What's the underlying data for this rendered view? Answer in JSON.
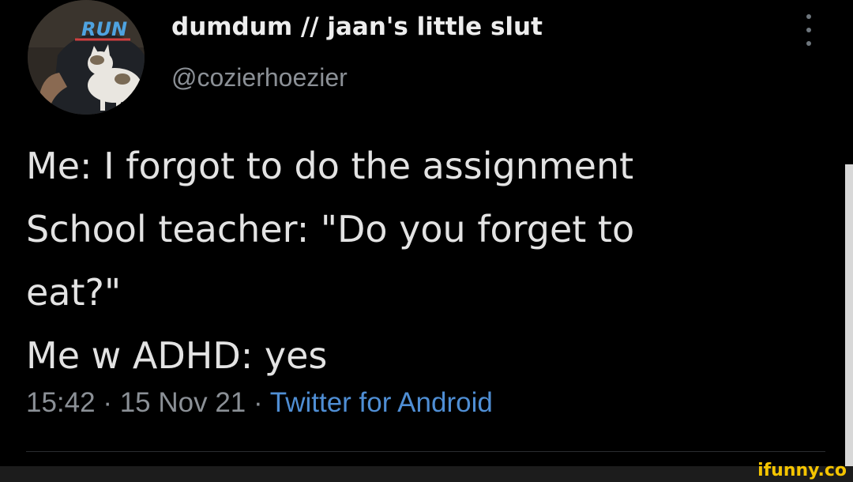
{
  "tweet": {
    "display_name": "dumdum // jaan's little slut",
    "handle": "@cozierhoezier",
    "lines": [
      "Me: I forgot to do the assignment",
      "School teacher: \"Do you forget to",
      "eat?\"",
      "Me w ADHD: yes"
    ],
    "time": "15:42",
    "separator": " · ",
    "date": "15 Nov 21",
    "source": "Twitter for Android",
    "avatar_shirt_text": "RUN"
  },
  "icons": {
    "more": "more-vertical-icon",
    "avatar": "profile-avatar"
  },
  "colors": {
    "background": "#000000",
    "text": "#e7e9ea",
    "muted": "#8b9096",
    "link": "#4f8ed4",
    "watermark": "#f4c400"
  },
  "watermark": "ifunny.co"
}
